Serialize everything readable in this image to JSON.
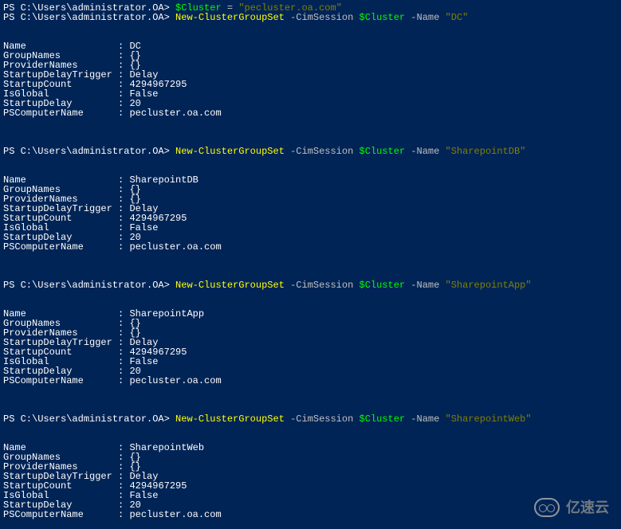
{
  "prompt": "PS C:\\Users\\administrator.OA> ",
  "commands": {
    "assign": {
      "var": "$Cluster",
      "op": " = ",
      "value": "\"pecluster.oa.com\""
    },
    "cmd": "New-ClusterGroupSet",
    "param1": " -CimSession ",
    "arg1": "$Cluster",
    "param2": " -Name ",
    "names": {
      "dc": "\"DC\"",
      "spdb": "\"SharepointDB\"",
      "spapp": "\"SharepointApp\"",
      "spweb": "\"SharepointWeb\""
    }
  },
  "labels": {
    "name": "Name                : ",
    "groupNames": "GroupNames          : ",
    "providerNames": "ProviderNames       : ",
    "startupDelayTrigger": "StartupDelayTrigger : ",
    "startupCount": "StartupCount        : ",
    "isGlobal": "IsGlobal            : ",
    "startupDelay": "StartupDelay        : ",
    "psComputerName": "PSComputerName      : "
  },
  "values": {
    "dc": "DC",
    "spdb": "SharepointDB",
    "spapp": "SharepointApp",
    "spweb": "SharepointWeb",
    "empty": "{}",
    "delay": "Delay",
    "count": "4294967295",
    "false": "False",
    "twenty": "20",
    "host": "pecluster.oa.com"
  },
  "watermark": "亿速云"
}
